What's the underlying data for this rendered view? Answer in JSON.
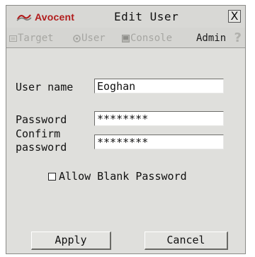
{
  "window": {
    "brand": "Avocent",
    "title": "Edit User",
    "close_glyph": "X"
  },
  "tabs": [
    {
      "label": "Target",
      "icon": "target-icon",
      "active": false
    },
    {
      "label": "User",
      "icon": "user-icon",
      "active": false
    },
    {
      "label": "Console",
      "icon": "console-icon",
      "active": false
    },
    {
      "label": "Admin",
      "icon": null,
      "active": true
    }
  ],
  "help_glyph": "?",
  "form": {
    "username_label": "User name",
    "username_value": "Eoghan",
    "password_label": "Password",
    "password_value": "********",
    "confirm_label_line1": "Confirm",
    "confirm_label_line2": "password",
    "confirm_value": "********",
    "allow_blank_label": "Allow Blank Password",
    "allow_blank_checked": false
  },
  "buttons": {
    "apply": "Apply",
    "cancel": "Cancel"
  },
  "colors": {
    "brand": "#b11c1c",
    "window_bg": "#dfdfdc",
    "inactive_tab": "#a6a6a2"
  }
}
